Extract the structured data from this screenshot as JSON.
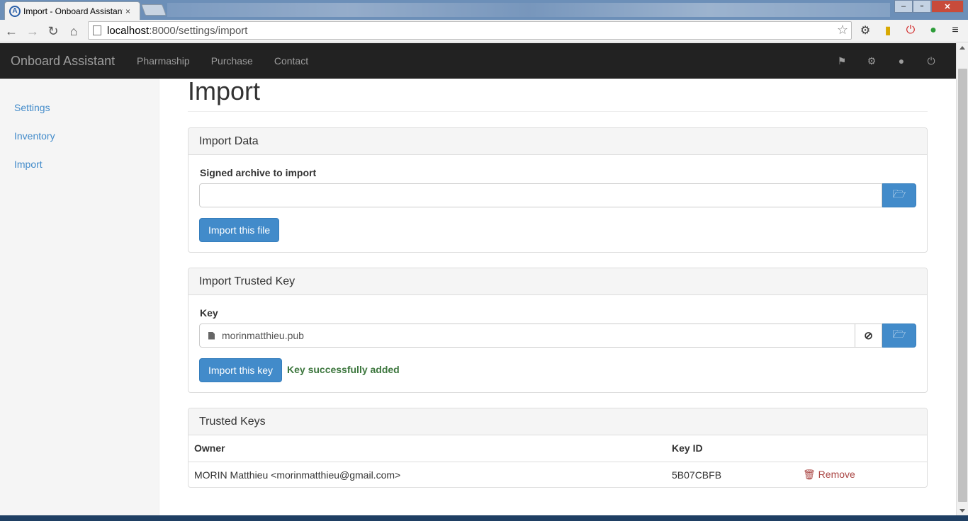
{
  "browser": {
    "tab_title": "Import - Onboard Assistant",
    "tab_close": "×",
    "favicon_letter": "A",
    "url_host": "localhost",
    "url_rest": ":8000/settings/import",
    "win_min": "–",
    "win_max": "▫",
    "win_close": "✕"
  },
  "navbar": {
    "brand": "Onboard Assistant",
    "links": [
      "Pharmaship",
      "Purchase",
      "Contact"
    ],
    "icons": [
      "flag-icon",
      "gear-icon",
      "user-icon",
      "power-icon"
    ]
  },
  "sidebar": {
    "items": [
      "Settings",
      "Inventory",
      "Import"
    ]
  },
  "page": {
    "title": "Import"
  },
  "import_data": {
    "heading": "Import Data",
    "label": "Signed archive to import",
    "value": "",
    "button": "Import this file"
  },
  "import_key": {
    "heading": "Import Trusted Key",
    "label": "Key",
    "file_name": "morinmatthieu.pub",
    "button": "Import this key",
    "status": "Key successfully added"
  },
  "trusted_keys": {
    "heading": "Trusted Keys",
    "columns": [
      "Owner",
      "Key ID",
      ""
    ],
    "rows": [
      {
        "owner": "MORIN Matthieu <morinmatthieu@gmail.com>",
        "key_id": "5B07CBFB",
        "action": "Remove"
      }
    ]
  },
  "colors": {
    "primary": "#428bca",
    "navbar": "#222222",
    "success": "#3c763d",
    "danger": "#a94442"
  }
}
